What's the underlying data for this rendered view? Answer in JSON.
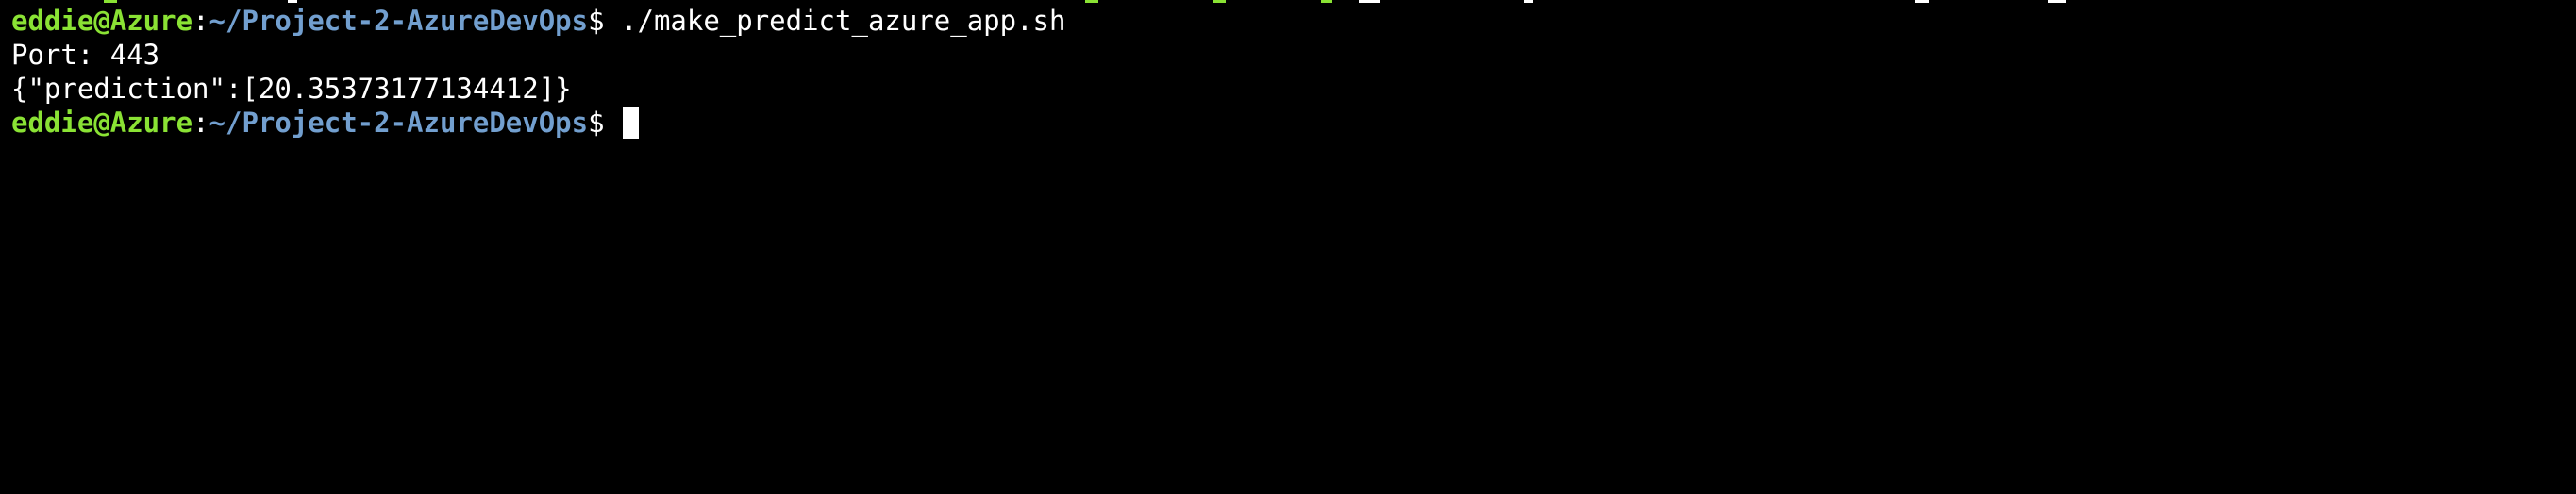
{
  "terminal": {
    "colors": {
      "background": "#000000",
      "foreground": "#ffffff",
      "user_host": "#8ae234",
      "path": "#729fcf",
      "cursor": "#ffffff"
    },
    "lines": [
      {
        "type": "prompt",
        "user_host": "eddie@Azure",
        "separator": ":",
        "path": "~/Project-2-AzureDevOps",
        "prompt_symbol": "$",
        "command": "./make_predict_azure_app.sh"
      },
      {
        "type": "output",
        "text": "Port: 443"
      },
      {
        "type": "output",
        "text": "{\"prediction\":[20.35373177134412]}"
      },
      {
        "type": "prompt",
        "user_host": "eddie@Azure",
        "separator": ":",
        "path": "~/Project-2-AzureDevOps",
        "prompt_symbol": "$",
        "command": ""
      }
    ]
  }
}
